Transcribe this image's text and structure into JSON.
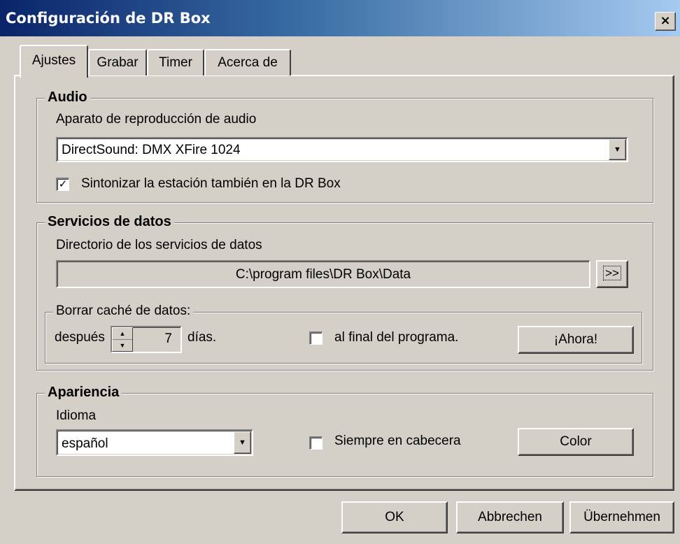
{
  "window": {
    "title": "Configuración de DR Box",
    "close_glyph": "×"
  },
  "tabs": [
    "Ajustes",
    "Grabar",
    "Timer",
    "Acerca de"
  ],
  "audio": {
    "group_title": "Audio",
    "device_label": "Aparato de reproducción de audio",
    "device_value": "DirectSound: DMX XFire 1024",
    "tune_label": "Sintonizar la estación también en la DR Box",
    "tune_checked": true
  },
  "data_services": {
    "group_title": "Servicios de datos",
    "dir_label": "Directorio de los servicios de datos",
    "dir_value": "C:\\program files\\DR Box\\Data",
    "browse_label": ">>",
    "cache": {
      "group_title": "Borrar caché de datos:",
      "after_label": "después",
      "days_value": "7",
      "days_label": "días.",
      "end_label": "al final del programa.",
      "end_checked": false,
      "now_button": "¡Ahora!"
    }
  },
  "appearance": {
    "group_title": "Apariencia",
    "language_label": "Idioma",
    "language_value": "español",
    "always_on_top_label": "Siempre en cabecera",
    "always_on_top_checked": false,
    "color_button": "Color"
  },
  "footer": {
    "ok": "OK",
    "cancel": "Abbrechen",
    "apply": "Übernehmen"
  },
  "colors": {
    "face": "#d4d0c8",
    "title_start": "#0a246a",
    "title_end": "#a6caf0"
  },
  "icons": {
    "dropdown": "triangle-down-icon",
    "close": "close-icon"
  }
}
